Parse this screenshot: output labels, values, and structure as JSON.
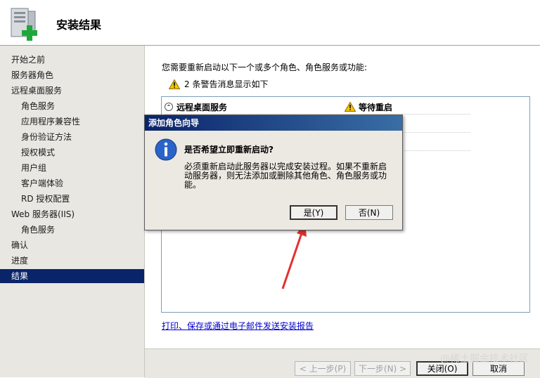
{
  "header": {
    "title": "安装结果"
  },
  "sidebar": {
    "items": [
      {
        "label": "开始之前",
        "level": 0
      },
      {
        "label": "服务器角色",
        "level": 0
      },
      {
        "label": "远程桌面服务",
        "level": 0
      },
      {
        "label": "角色服务",
        "level": 1
      },
      {
        "label": "应用程序兼容性",
        "level": 1
      },
      {
        "label": "身份验证方法",
        "level": 1
      },
      {
        "label": "授权模式",
        "level": 1
      },
      {
        "label": "用户组",
        "level": 1
      },
      {
        "label": "客户端体验",
        "level": 1
      },
      {
        "label": "RD 授权配置",
        "level": 1
      },
      {
        "label": "Web 服务器(IIS)",
        "level": 0
      },
      {
        "label": "角色服务",
        "level": 1
      },
      {
        "label": "确认",
        "level": 0
      },
      {
        "label": "进度",
        "level": 0
      },
      {
        "label": "结果",
        "level": 0,
        "active": true
      }
    ]
  },
  "main": {
    "intro": "您需要重新启动以下一个或多个角色、角色服务或功能:",
    "warning_summary": "2 条警告消息显示如下",
    "results": [
      {
        "name": "远程桌面服务",
        "status": "等待重启"
      }
    ],
    "report_link": "打印、保存或通过电子邮件发送安装报告"
  },
  "footer": {
    "prev_label": "< 上一步(P)",
    "next_label": "下一步(N) >",
    "close_label": "关闭(O)",
    "cancel_label": "取消"
  },
  "watermark": "@稀土掘金技术社区",
  "dialog": {
    "title": "添加角色向导",
    "question": "是否希望立即重新启动?",
    "detail": "必须重新启动此服务器以完成安装过程。如果不重新启动服务器，则无法添加或删除其他角色、角色服务或功能。",
    "yes_label": "是(Y)",
    "no_label": "否(N)"
  },
  "colors": {
    "selection": "#0a246a",
    "link": "#0000cc",
    "title_bar": "#0a246a",
    "warning": "#f5c400",
    "arrow": "#e53030"
  },
  "icons": {
    "header": "server-install-icon",
    "warning": "warning-icon",
    "info": "info-icon"
  }
}
